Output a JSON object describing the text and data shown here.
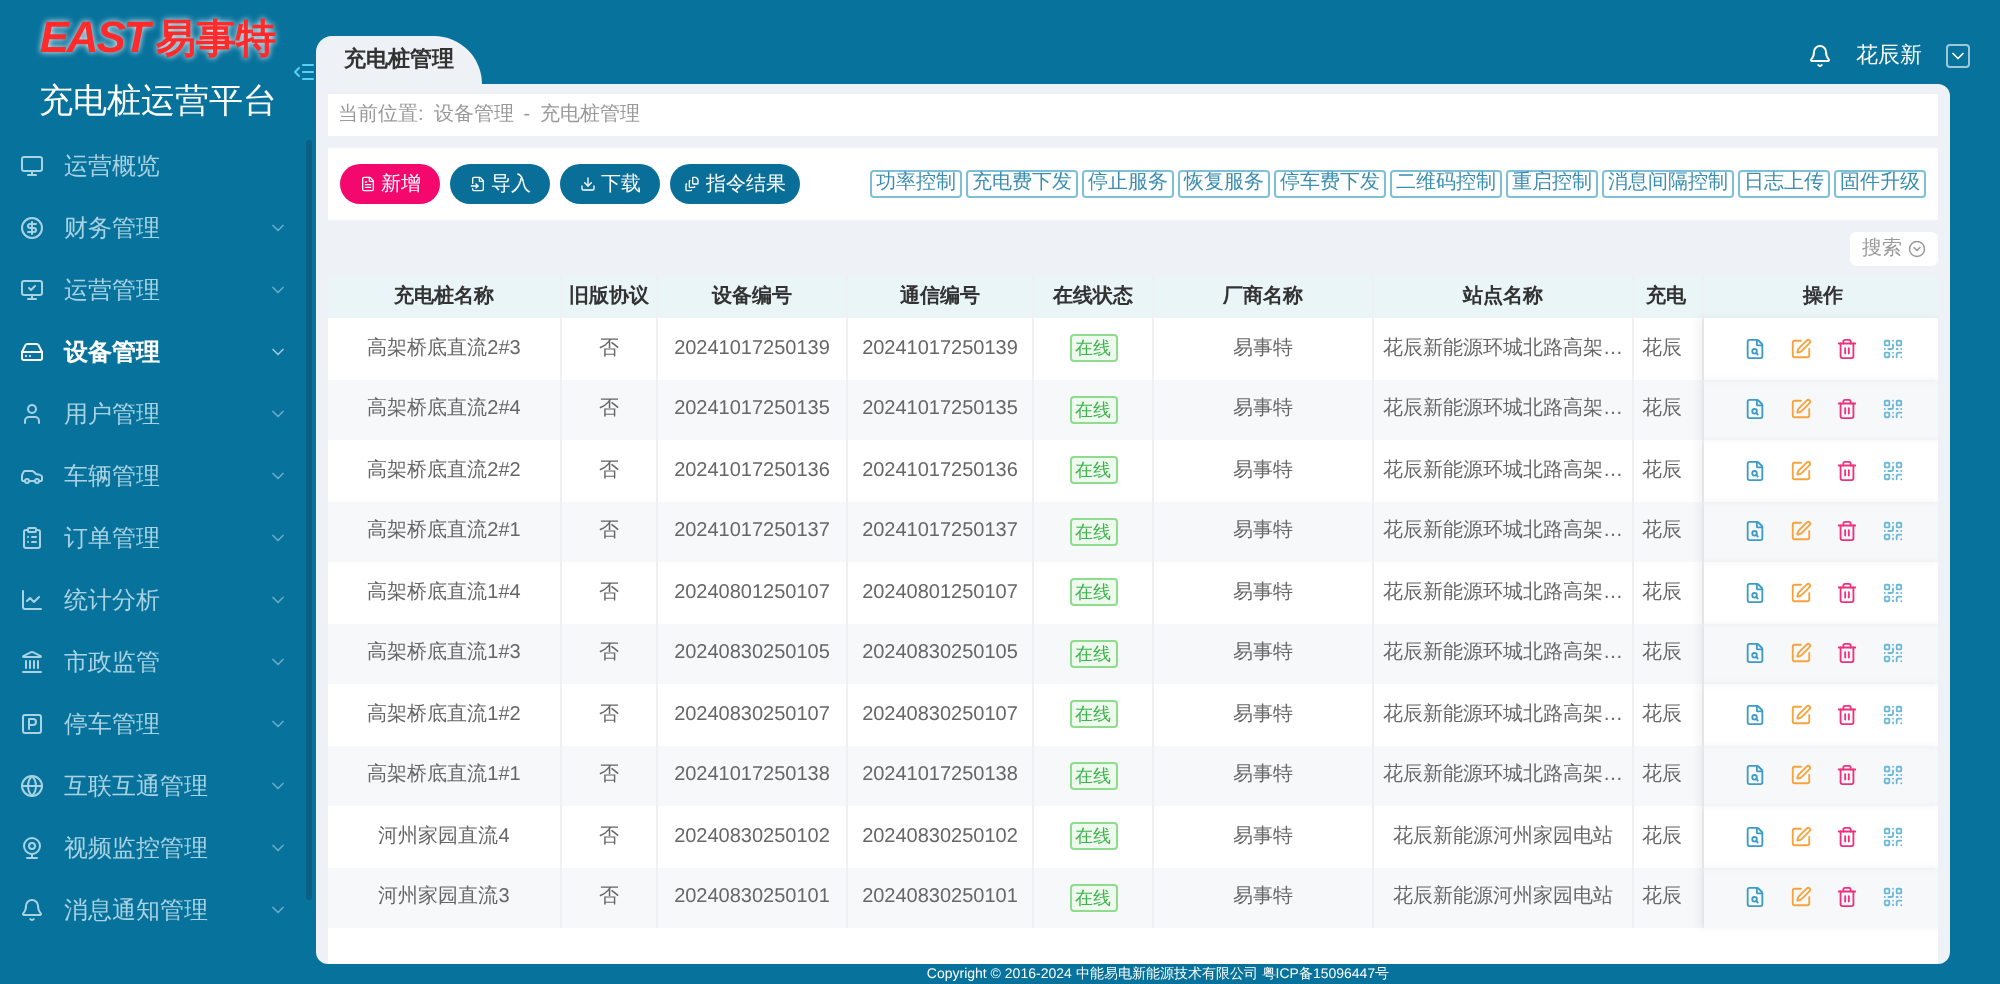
{
  "logo": {
    "latin": "EAST",
    "chinese": "易事特"
  },
  "platform_title": "充电桩运营平台",
  "sidebar": {
    "items": [
      {
        "label": "运营概览",
        "expandable": false,
        "selected": false
      },
      {
        "label": "财务管理",
        "expandable": true,
        "selected": false
      },
      {
        "label": "运营管理",
        "expandable": true,
        "selected": false
      },
      {
        "label": "设备管理",
        "expandable": true,
        "selected": true
      },
      {
        "label": "用户管理",
        "expandable": true,
        "selected": false
      },
      {
        "label": "车辆管理",
        "expandable": true,
        "selected": false
      },
      {
        "label": "订单管理",
        "expandable": true,
        "selected": false
      },
      {
        "label": "统计分析",
        "expandable": true,
        "selected": false
      },
      {
        "label": "市政监管",
        "expandable": true,
        "selected": false
      },
      {
        "label": "停车管理",
        "expandable": true,
        "selected": false
      },
      {
        "label": "互联互通管理",
        "expandable": true,
        "selected": false
      },
      {
        "label": "视频监控管理",
        "expandable": true,
        "selected": false
      },
      {
        "label": "消息通知管理",
        "expandable": true,
        "selected": false
      }
    ]
  },
  "tab": {
    "label": "充电桩管理",
    "selected": true
  },
  "user": {
    "name": "花辰新"
  },
  "breadcrumb": {
    "prefix": "当前位置:",
    "items": [
      "设备管理",
      "充电桩管理"
    ],
    "separator": "-"
  },
  "toolbar": {
    "buttons": [
      {
        "label": "新增",
        "kind": "primary"
      },
      {
        "label": "导入",
        "kind": "normal"
      },
      {
        "label": "下载",
        "kind": "normal"
      },
      {
        "label": "指令结果",
        "kind": "normal"
      }
    ],
    "commands": [
      "功率控制",
      "充电费下发",
      "停止服务",
      "恢复服务",
      "停车费下发",
      "二维码控制",
      "重启控制",
      "消息间隔控制",
      "日志上传",
      "固件升级"
    ]
  },
  "search_button": "搜索",
  "table": {
    "columns": [
      "充电桩名称",
      "旧版协议",
      "设备编号",
      "通信编号",
      "在线状态",
      "厂商名称",
      "站点名称",
      "充电",
      "操作"
    ],
    "rows": [
      {
        "name": "高架桥底直流2#3",
        "legacy": "否",
        "device_no": "20241017250139",
        "comm_no": "20241017250139",
        "status": {
          "text": "在线",
          "kind": "online"
        },
        "vendor": "易事特",
        "station": "花辰新能源环城北路高架…",
        "column_8": "花辰"
      },
      {
        "name": "高架桥底直流2#4",
        "legacy": "否",
        "device_no": "20241017250135",
        "comm_no": "20241017250135",
        "status": {
          "text": "在线",
          "kind": "online"
        },
        "vendor": "易事特",
        "station": "花辰新能源环城北路高架…",
        "column_8": "花辰"
      },
      {
        "name": "高架桥底直流2#2",
        "legacy": "否",
        "device_no": "20241017250136",
        "comm_no": "20241017250136",
        "status": {
          "text": "在线",
          "kind": "online"
        },
        "vendor": "易事特",
        "station": "花辰新能源环城北路高架…",
        "column_8": "花辰"
      },
      {
        "name": "高架桥底直流2#1",
        "legacy": "否",
        "device_no": "20241017250137",
        "comm_no": "20241017250137",
        "status": {
          "text": "在线",
          "kind": "online"
        },
        "vendor": "易事特",
        "station": "花辰新能源环城北路高架…",
        "column_8": "花辰"
      },
      {
        "name": "高架桥底直流1#4",
        "legacy": "否",
        "device_no": "20240801250107",
        "comm_no": "20240801250107",
        "status": {
          "text": "在线",
          "kind": "online"
        },
        "vendor": "易事特",
        "station": "花辰新能源环城北路高架…",
        "column_8": "花辰"
      },
      {
        "name": "高架桥底直流1#3",
        "legacy": "否",
        "device_no": "20240830250105",
        "comm_no": "20240830250105",
        "status": {
          "text": "在线",
          "kind": "online"
        },
        "vendor": "易事特",
        "station": "花辰新能源环城北路高架…",
        "column_8": "花辰"
      },
      {
        "name": "高架桥底直流1#2",
        "legacy": "否",
        "device_no": "20240830250107",
        "comm_no": "20240830250107",
        "status": {
          "text": "在线",
          "kind": "online"
        },
        "vendor": "易事特",
        "station": "花辰新能源环城北路高架…",
        "column_8": "花辰"
      },
      {
        "name": "高架桥底直流1#1",
        "legacy": "否",
        "device_no": "20241017250138",
        "comm_no": "20241017250138",
        "status": {
          "text": "在线",
          "kind": "online"
        },
        "vendor": "易事特",
        "station": "花辰新能源环城北路高架…",
        "column_8": "花辰"
      },
      {
        "name": "河州家园直流4",
        "legacy": "否",
        "device_no": "20240830250102",
        "comm_no": "20240830250102",
        "status": {
          "text": "在线",
          "kind": "online"
        },
        "vendor": "易事特",
        "station": "花辰新能源河州家园电站",
        "column_8": "花辰"
      },
      {
        "name": "河州家园直流3",
        "legacy": "否",
        "device_no": "20240830250101",
        "comm_no": "20240830250101",
        "status": {
          "text": "在线",
          "kind": "online"
        },
        "vendor": "易事特",
        "station": "花辰新能源河州家园电站",
        "column_8": "花辰"
      }
    ]
  },
  "footer": "Copyright © 2016-2024 中能易电新能源技术有限公司 粤ICP备15096447号"
}
